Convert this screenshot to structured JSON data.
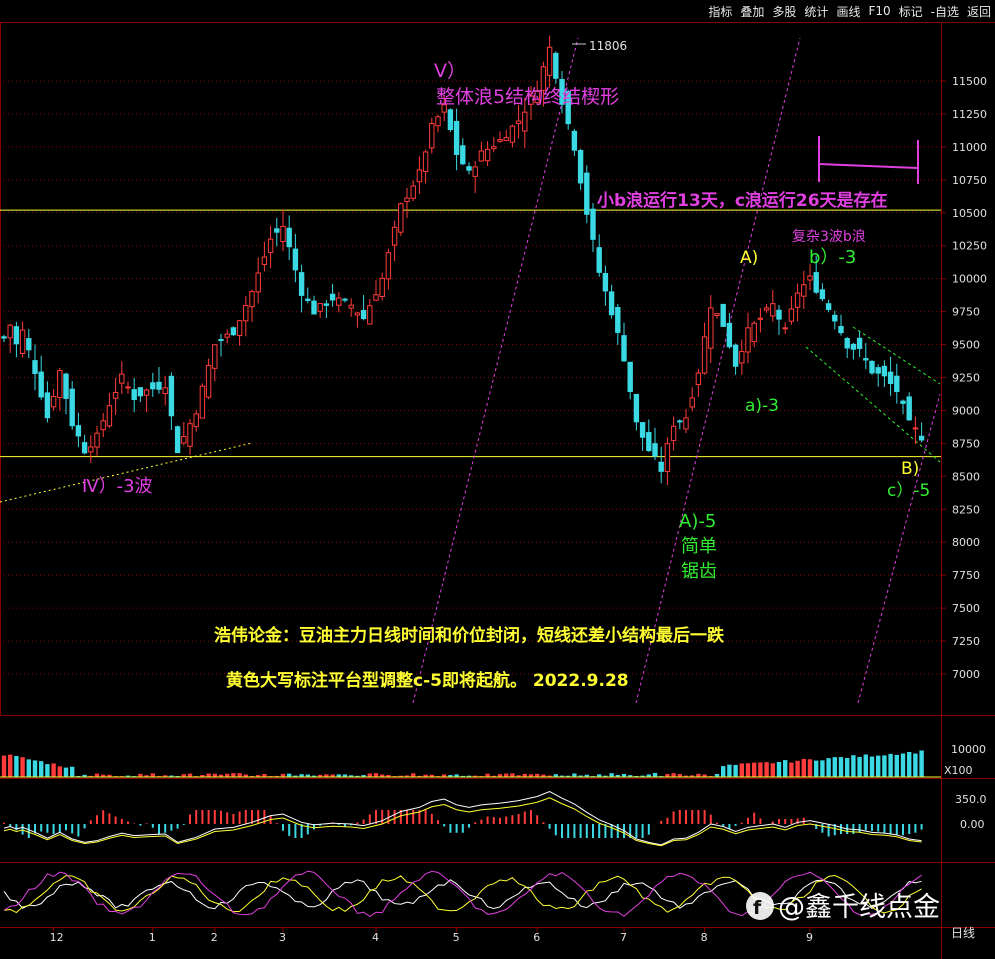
{
  "toolbar": {
    "items": [
      "指标",
      "叠加",
      "多股",
      "统计",
      "画线",
      "F10",
      "标记",
      "-自选",
      "返回"
    ]
  },
  "colors": {
    "up": "#ff3b3b",
    "down": "#3ad9e4",
    "yellow": "#ffff33",
    "magenta": "#e040e0",
    "green": "#33ee33",
    "grid": "#8a0000",
    "axis_text": "#e0e0e0"
  },
  "annotations": {
    "wave5_title": "V）",
    "wave5_desc": "整体浪5结构终结楔形",
    "small_b": "小b浪运行13天，c浪运行26天是存在",
    "complex_b": "复杂3波b浪",
    "A_label": "A)",
    "b_label": "b）-3",
    "a_label": "a)-3",
    "A5_label": "A)-5",
    "simple": "简单",
    "sawtooth": "锯齿",
    "B_label": "B)",
    "c_label": "c）-5",
    "wave4": "Ⅳ）-3波",
    "note1": "浩伟论金：豆油主力日线时间和价位封闭，短线还差小结构最后一跌",
    "note2": "黄色大写标注平台型调整c-5即将起航。 2022.9.28",
    "high_price": "11806"
  },
  "volume_panel": {
    "axis_label": "10000",
    "unit": "X100"
  },
  "macd_panel": {
    "ticks": [
      "350.0",
      "0.00"
    ]
  },
  "period": "日线",
  "watermark": "@鑫千线点金",
  "chart_data": {
    "type": "candlestick",
    "y_ticks": [
      11500,
      11250,
      11000,
      10750,
      10500,
      10250,
      10000,
      9750,
      9500,
      9250,
      9000,
      8750,
      8500,
      8250,
      8000,
      7750,
      7500,
      7250,
      7000
    ],
    "ylim": [
      6700,
      11900
    ],
    "x_ticks": [
      "12",
      "1",
      "2",
      "3",
      "4",
      "5",
      "6",
      "7",
      "8",
      "9"
    ],
    "x_tick_index": [
      8,
      24,
      34,
      45,
      60,
      73,
      86,
      100,
      113,
      130
    ],
    "horizontal_lines": [
      10520,
      8650
    ],
    "key_points": [
      {
        "label": "start",
        "i": 0,
        "price": 9550
      },
      {
        "i": 1,
        "price": 9650
      },
      {
        "i": 2,
        "price": 9500
      },
      {
        "i": 3,
        "price": 9600
      },
      {
        "i": 5,
        "price": 9300
      },
      {
        "i": 7,
        "price": 8950
      },
      {
        "i": 9,
        "price": 9300
      },
      {
        "i": 11,
        "price": 8900
      },
      {
        "i": 13,
        "price": 8700
      },
      {
        "i": 15,
        "price": 8800
      },
      {
        "i": 17,
        "price": 9050
      },
      {
        "i": 19,
        "price": 9250
      },
      {
        "i": 21,
        "price": 9100
      },
      {
        "i": 23,
        "price": 9150
      },
      {
        "i": 26,
        "price": 9200
      },
      {
        "i": 28,
        "price": 8700
      },
      {
        "i": 31,
        "price": 9000
      },
      {
        "i": 34,
        "price": 9500
      },
      {
        "i": 37,
        "price": 9600
      },
      {
        "i": 40,
        "price": 9900
      },
      {
        "i": 43,
        "price": 10300
      },
      {
        "i": 45,
        "price": 10400
      },
      {
        "i": 48,
        "price": 9900
      },
      {
        "i": 50,
        "price": 9750
      },
      {
        "i": 53,
        "price": 9850
      },
      {
        "i": 56,
        "price": 9800
      },
      {
        "i": 58,
        "price": 9700
      },
      {
        "i": 61,
        "price": 10000
      },
      {
        "i": 64,
        "price": 10550
      },
      {
        "i": 67,
        "price": 10800
      },
      {
        "i": 69,
        "price": 11150
      },
      {
        "i": 71,
        "price": 11300
      },
      {
        "i": 73,
        "price": 10950
      },
      {
        "i": 75,
        "price": 10800
      },
      {
        "i": 77,
        "price": 10950
      },
      {
        "i": 80,
        "price": 11050
      },
      {
        "i": 83,
        "price": 11200
      },
      {
        "i": 86,
        "price": 11450
      },
      {
        "i": 88,
        "price": 11750
      },
      {
        "i": 90,
        "price": 11350
      },
      {
        "i": 92,
        "price": 11000
      },
      {
        "i": 94,
        "price": 10500
      },
      {
        "i": 96,
        "price": 10050
      },
      {
        "i": 98,
        "price": 9750
      },
      {
        "i": 100,
        "price": 9400
      },
      {
        "i": 102,
        "price": 8900
      },
      {
        "i": 104,
        "price": 8700
      },
      {
        "i": 106,
        "price": 8550
      },
      {
        "i": 108,
        "price": 8900
      },
      {
        "i": 110,
        "price": 8950
      },
      {
        "i": 112,
        "price": 9300
      },
      {
        "i": 114,
        "price": 9800
      },
      {
        "i": 116,
        "price": 9650
      },
      {
        "i": 118,
        "price": 9350
      },
      {
        "i": 120,
        "price": 9600
      },
      {
        "i": 122,
        "price": 9700
      },
      {
        "i": 124,
        "price": 9800
      },
      {
        "i": 126,
        "price": 9600
      },
      {
        "i": 128,
        "price": 9900
      },
      {
        "i": 130,
        "price": 10000
      },
      {
        "i": 132,
        "price": 9850
      },
      {
        "i": 134,
        "price": 9700
      },
      {
        "i": 136,
        "price": 9500
      },
      {
        "i": 138,
        "price": 9450
      },
      {
        "i": 140,
        "price": 9300
      },
      {
        "i": 142,
        "price": 9250
      },
      {
        "i": 144,
        "price": 9150
      },
      {
        "i": 146,
        "price": 8900
      },
      {
        "i": 148,
        "price": 8800
      }
    ]
  }
}
